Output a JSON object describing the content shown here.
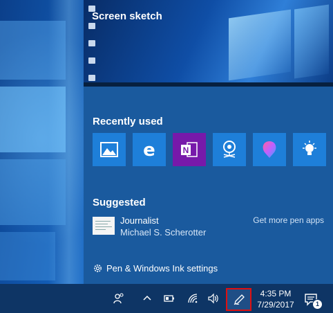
{
  "flyout": {
    "sketch_title": "Screen sketch",
    "recent_title": "Recently used",
    "recent_apps": [
      {
        "icon": "photos-icon",
        "name": "Photos"
      },
      {
        "icon": "edge-icon",
        "name": "Microsoft Edge"
      },
      {
        "icon": "onenote-icon",
        "name": "OneNote"
      },
      {
        "icon": "maps-icon",
        "name": "Maps"
      },
      {
        "icon": "paint3d-icon",
        "name": "Paint 3D"
      },
      {
        "icon": "tips-icon",
        "name": "Tips"
      }
    ],
    "suggested_title": "Suggested",
    "suggested_app": {
      "name": "Journalist",
      "author": "Michael S. Scherotter"
    },
    "get_more": "Get more pen apps",
    "settings_label": "Pen & Windows Ink settings"
  },
  "taskbar": {
    "time": "4:35 PM",
    "date": "7/29/2017",
    "notification_count": "1"
  },
  "colors": {
    "tile_blue": "#1e7fd9",
    "onenote_purple": "#7719aa",
    "highlight_red": "#e01010",
    "taskbar": "#0e3565"
  }
}
